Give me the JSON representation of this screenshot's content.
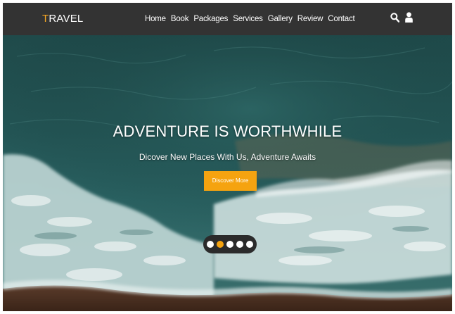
{
  "nav": {
    "brand_first_letter": "T",
    "brand_rest": "RAVEL",
    "links": [
      "Home",
      "Book",
      "Packages",
      "Services",
      "Gallery",
      "Review",
      "Contact"
    ],
    "icons": [
      "search-icon",
      "user-icon"
    ]
  },
  "hero": {
    "title": "ADVENTURE IS WORTHWHILE",
    "subtitle": "Dicover New Places With Us, Adventure Awaits",
    "button_label": "Discover More",
    "slider": {
      "total_slides": 5,
      "active_index": 1
    }
  },
  "colors": {
    "accent": "#f5a310",
    "navbar": "#333333",
    "text": "#ffffff"
  }
}
